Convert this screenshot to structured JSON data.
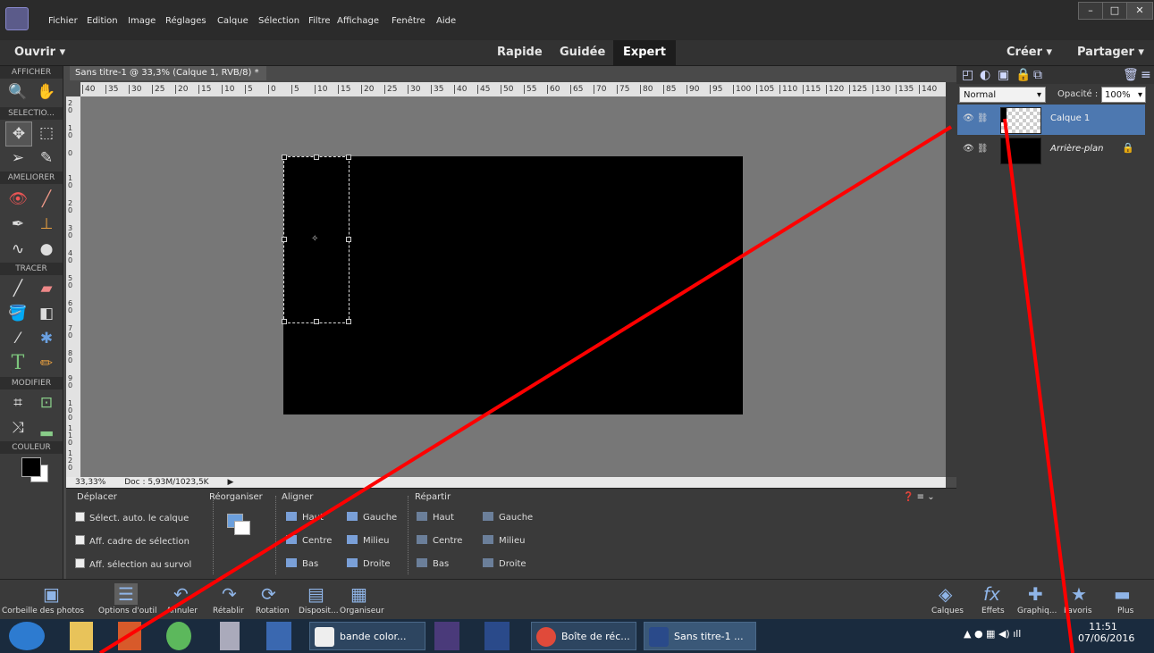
{
  "menu": [
    "Fichier",
    "Edition",
    "Image",
    "Réglages",
    "Calque",
    "Sélection",
    "Filtre",
    "Affichage",
    "Fenêtre",
    "Aide"
  ],
  "window_controls": {
    "minimize": "–",
    "maximize": "□",
    "close": "✕"
  },
  "modebar": {
    "open": "Ouvrir",
    "modes": [
      "Rapide",
      "Guidée",
      "Expert"
    ],
    "create": "Créer",
    "share": "Partager"
  },
  "toolbox": {
    "sections": [
      "AFFICHER",
      "SELECTIO...",
      "AMELIORER",
      "TRACER",
      "MODIFIER",
      "COULEUR"
    ]
  },
  "document": {
    "tab": "Sans titre-1 @ 33,3% (Calque 1, RVB/8) *",
    "close": "×",
    "zoom": "33,33%",
    "doc_info": "Doc : 5,93M/1023,5K"
  },
  "ruler": {
    "h": [
      "40",
      "35",
      "30",
      "25",
      "20",
      "15",
      "10",
      "5",
      "0",
      "5",
      "10",
      "15",
      "20",
      "25",
      "30",
      "35",
      "40",
      "45",
      "50",
      "55",
      "60",
      "65",
      "70",
      "75",
      "80",
      "85",
      "90",
      "95",
      "100",
      "105",
      "110",
      "115",
      "120",
      "125",
      "130",
      "135",
      "140"
    ],
    "v": [
      "2 0",
      "1 0",
      "0",
      "1 0",
      "2 0",
      "3 0",
      "4 0",
      "5 0",
      "6 0",
      "7 0",
      "8 0",
      "9 0",
      "1 0 0",
      "1 1 0",
      "1 2 0"
    ]
  },
  "options": {
    "tool": "Déplacer",
    "checks": [
      "Sélect. auto. le calque",
      "Aff. cadre de sélection",
      "Aff. sélection au survol"
    ],
    "reorganize": "Réorganiser",
    "align": {
      "title": "Aligner",
      "items": [
        "Haut",
        "Centre",
        "Bas",
        "Gauche",
        "Milieu",
        "Droite"
      ]
    },
    "distribute": {
      "title": "Répartir",
      "items": [
        "Haut",
        "Centre",
        "Bas",
        "Gauche",
        "Milieu",
        "Droite"
      ]
    }
  },
  "layers_panel": {
    "blend_mode": "Normal",
    "opacity_label": "Opacité :",
    "opacity": "100%",
    "layers": [
      {
        "name": "Calque 1",
        "selected": true
      },
      {
        "name": "Arrière-plan",
        "selected": false
      }
    ]
  },
  "bottombar": {
    "left": [
      "Corbeille des photos",
      "Options d'outil",
      "Annuler",
      "Rétablir",
      "Rotation",
      "Disposit...",
      "Organiseur"
    ],
    "right": [
      "Calques",
      "Effets",
      "Graphiq...",
      "Favoris",
      "Plus"
    ]
  },
  "taskbar": {
    "items": [
      "bande color...",
      "Boîte de réc...",
      "Sans titre-1 ..."
    ],
    "time": "11:51",
    "date": "07/06/2016"
  },
  "colors": {
    "accent": "#4d78b0",
    "annotation": "#ff0000"
  }
}
